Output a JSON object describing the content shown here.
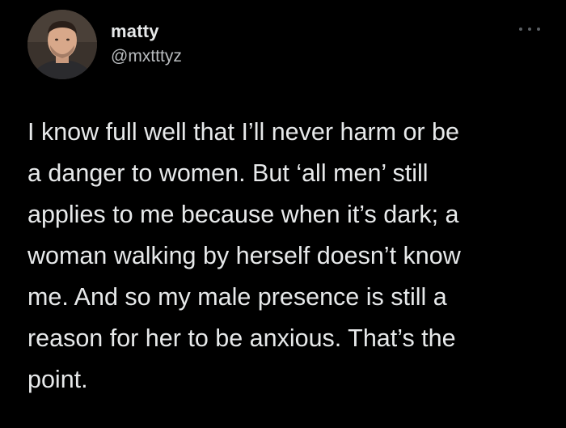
{
  "author": {
    "display_name": "matty",
    "handle": "@mxtttyz"
  },
  "more_icon": "more-horizontal-icon",
  "tweet": {
    "lines": [
      "I know full well that I’ll never harm or be",
      "a danger to women. But ‘all men’ still",
      "applies to me because when it’s dark; a",
      "woman walking by herself doesn’t know",
      "me. And so my male presence is still a",
      "reason for her to be anxious. That’s the",
      "point."
    ]
  },
  "colors": {
    "background": "#000000",
    "primary_text": "#e7e9ea",
    "secondary_text": "#b9bcbf",
    "icon": "#5b5f63"
  }
}
